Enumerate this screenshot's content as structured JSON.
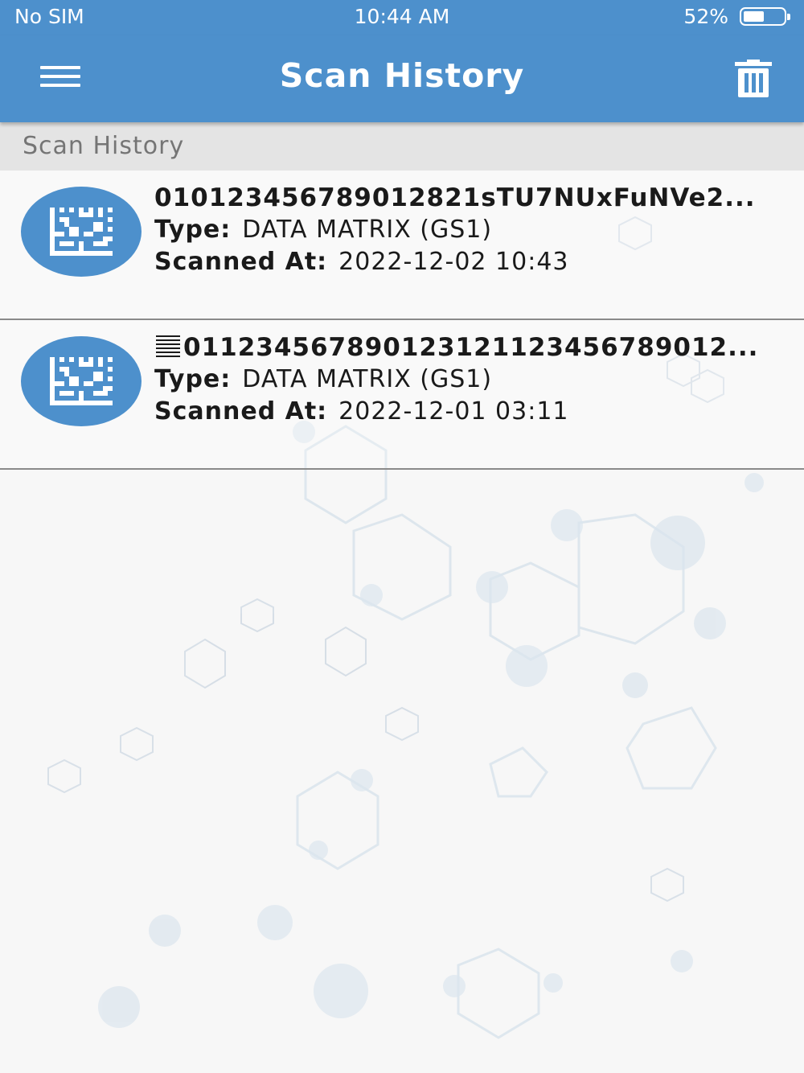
{
  "status_bar": {
    "carrier": "No SIM",
    "time": "10:44 AM",
    "battery": "52%",
    "battery_level": 0.52
  },
  "nav": {
    "title": "Scan History"
  },
  "section": {
    "title": "Scan History"
  },
  "labels": {
    "type": "Type:",
    "scanned_at": "Scanned At:"
  },
  "scans": [
    {
      "code": "01012345678901282​1sTU7NUxFuNVe2...",
      "type": "DATA MATRIX (GS1)",
      "scanned_at": "2022-12-02 10:43"
    },
    {
      "code": "011234567890123121123456789012...",
      "type": "DATA MATRIX (GS1)",
      "scanned_at": "2022-12-01 03:11"
    }
  ],
  "colors": {
    "accent": "#4d90cc",
    "section_bg": "#e4e4e4",
    "page_bg": "#f7f7f7"
  },
  "icons": {
    "menu": "hamburger-icon",
    "trash": "trash-icon",
    "item": "data-matrix-icon",
    "gs": "group-separator-icon"
  }
}
